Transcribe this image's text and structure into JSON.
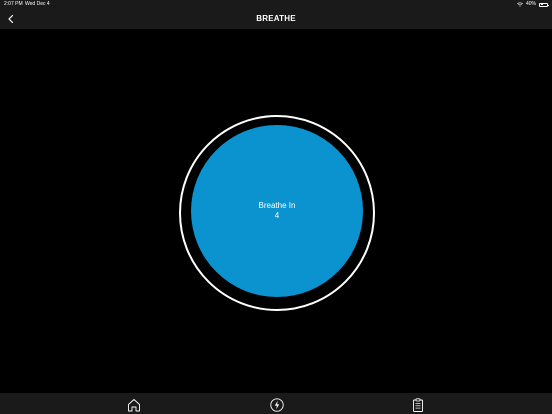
{
  "status_bar": {
    "time": "2:07 PM",
    "date": "Wed Dec 4",
    "battery": "40%",
    "battery_level": 0.4
  },
  "nav": {
    "title": "BREATHE",
    "back_icon": "chevron-left-icon"
  },
  "breathe": {
    "instruction": "Breathe In",
    "count": "4",
    "circle_color": "#0a93cf"
  },
  "tab_bar": {
    "tabs": [
      {
        "icon": "home-icon"
      },
      {
        "icon": "lightning-icon"
      },
      {
        "icon": "clipboard-icon"
      }
    ]
  }
}
